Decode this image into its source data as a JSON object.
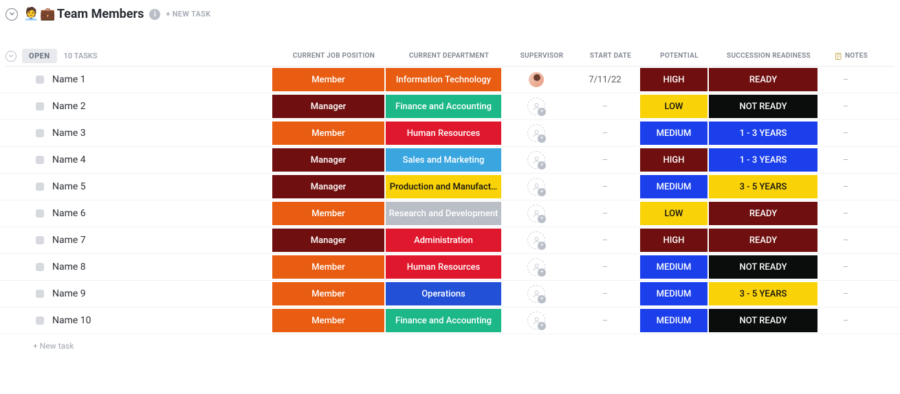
{
  "header": {
    "title": "Team Members",
    "emoji1": "🧑‍💼",
    "emoji2": "💼",
    "new_task": "+ NEW TASK"
  },
  "group": {
    "status": "OPEN",
    "count": "10 TASKS"
  },
  "columns": {
    "name": "",
    "position": "CURRENT JOB POSITION",
    "department": "CURRENT DEPARTMENT",
    "supervisor": "SUPERVISOR",
    "start_date": "START DATE",
    "potential": "POTENTIAL",
    "succession": "SUCCESSION READINESS",
    "notes": "NOTES"
  },
  "footer": {
    "new_task": "+ New task"
  },
  "rows": [
    {
      "name": "Name 1",
      "position": {
        "label": "Member",
        "color": "c-orange"
      },
      "department": {
        "label": "Information Technology",
        "color": "c-orange"
      },
      "supervisor": "avatar",
      "start_date": "7/11/22",
      "potential": {
        "label": "HIGH",
        "color": "c-darkred"
      },
      "succession": {
        "label": "READY",
        "color": "c-darkred"
      },
      "notes": "–"
    },
    {
      "name": "Name 2",
      "position": {
        "label": "Manager",
        "color": "c-maroon"
      },
      "department": {
        "label": "Finance and Accounting",
        "color": "c-green"
      },
      "supervisor": "empty",
      "start_date": "–",
      "potential": {
        "label": "LOW",
        "color": "c-yellow"
      },
      "succession": {
        "label": "NOT READY",
        "color": "c-black"
      },
      "notes": "–"
    },
    {
      "name": "Name 3",
      "position": {
        "label": "Member",
        "color": "c-orange"
      },
      "department": {
        "label": "Human Resources",
        "color": "c-red"
      },
      "supervisor": "empty",
      "start_date": "–",
      "potential": {
        "label": "MEDIUM",
        "color": "c-blue"
      },
      "succession": {
        "label": "1 - 3 YEARS",
        "color": "c-blue"
      },
      "notes": "–"
    },
    {
      "name": "Name 4",
      "position": {
        "label": "Manager",
        "color": "c-maroon"
      },
      "department": {
        "label": "Sales and Marketing",
        "color": "c-skyblue"
      },
      "supervisor": "empty",
      "start_date": "–",
      "potential": {
        "label": "HIGH",
        "color": "c-darkred"
      },
      "succession": {
        "label": "1 - 3 YEARS",
        "color": "c-blue"
      },
      "notes": "–"
    },
    {
      "name": "Name 5",
      "position": {
        "label": "Manager",
        "color": "c-maroon"
      },
      "department": {
        "label": "Production and Manufact…",
        "color": "c-yellow"
      },
      "supervisor": "empty",
      "start_date": "–",
      "potential": {
        "label": "MEDIUM",
        "color": "c-blue"
      },
      "succession": {
        "label": "3 - 5 YEARS",
        "color": "c-yellow"
      },
      "notes": "–"
    },
    {
      "name": "Name 6",
      "position": {
        "label": "Member",
        "color": "c-orange"
      },
      "department": {
        "label": "Research and Development",
        "color": "c-gray"
      },
      "supervisor": "empty",
      "start_date": "–",
      "potential": {
        "label": "LOW",
        "color": "c-yellow"
      },
      "succession": {
        "label": "READY",
        "color": "c-darkred"
      },
      "notes": "–"
    },
    {
      "name": "Name 7",
      "position": {
        "label": "Manager",
        "color": "c-maroon"
      },
      "department": {
        "label": "Administration",
        "color": "c-red"
      },
      "supervisor": "empty",
      "start_date": "–",
      "potential": {
        "label": "HIGH",
        "color": "c-darkred"
      },
      "succession": {
        "label": "READY",
        "color": "c-darkred"
      },
      "notes": "–"
    },
    {
      "name": "Name 8",
      "position": {
        "label": "Member",
        "color": "c-orange"
      },
      "department": {
        "label": "Human Resources",
        "color": "c-red"
      },
      "supervisor": "empty",
      "start_date": "–",
      "potential": {
        "label": "MEDIUM",
        "color": "c-blue"
      },
      "succession": {
        "label": "NOT READY",
        "color": "c-black"
      },
      "notes": "–"
    },
    {
      "name": "Name 9",
      "position": {
        "label": "Member",
        "color": "c-orange"
      },
      "department": {
        "label": "Operations",
        "color": "c-blue2"
      },
      "supervisor": "empty",
      "start_date": "–",
      "potential": {
        "label": "MEDIUM",
        "color": "c-blue"
      },
      "succession": {
        "label": "3 - 5 YEARS",
        "color": "c-yellow"
      },
      "notes": "–"
    },
    {
      "name": "Name 10",
      "position": {
        "label": "Member",
        "color": "c-orange"
      },
      "department": {
        "label": "Finance and Accounting",
        "color": "c-green"
      },
      "supervisor": "empty",
      "start_date": "–",
      "potential": {
        "label": "MEDIUM",
        "color": "c-blue"
      },
      "succession": {
        "label": "NOT READY",
        "color": "c-black"
      },
      "notes": "–"
    }
  ]
}
